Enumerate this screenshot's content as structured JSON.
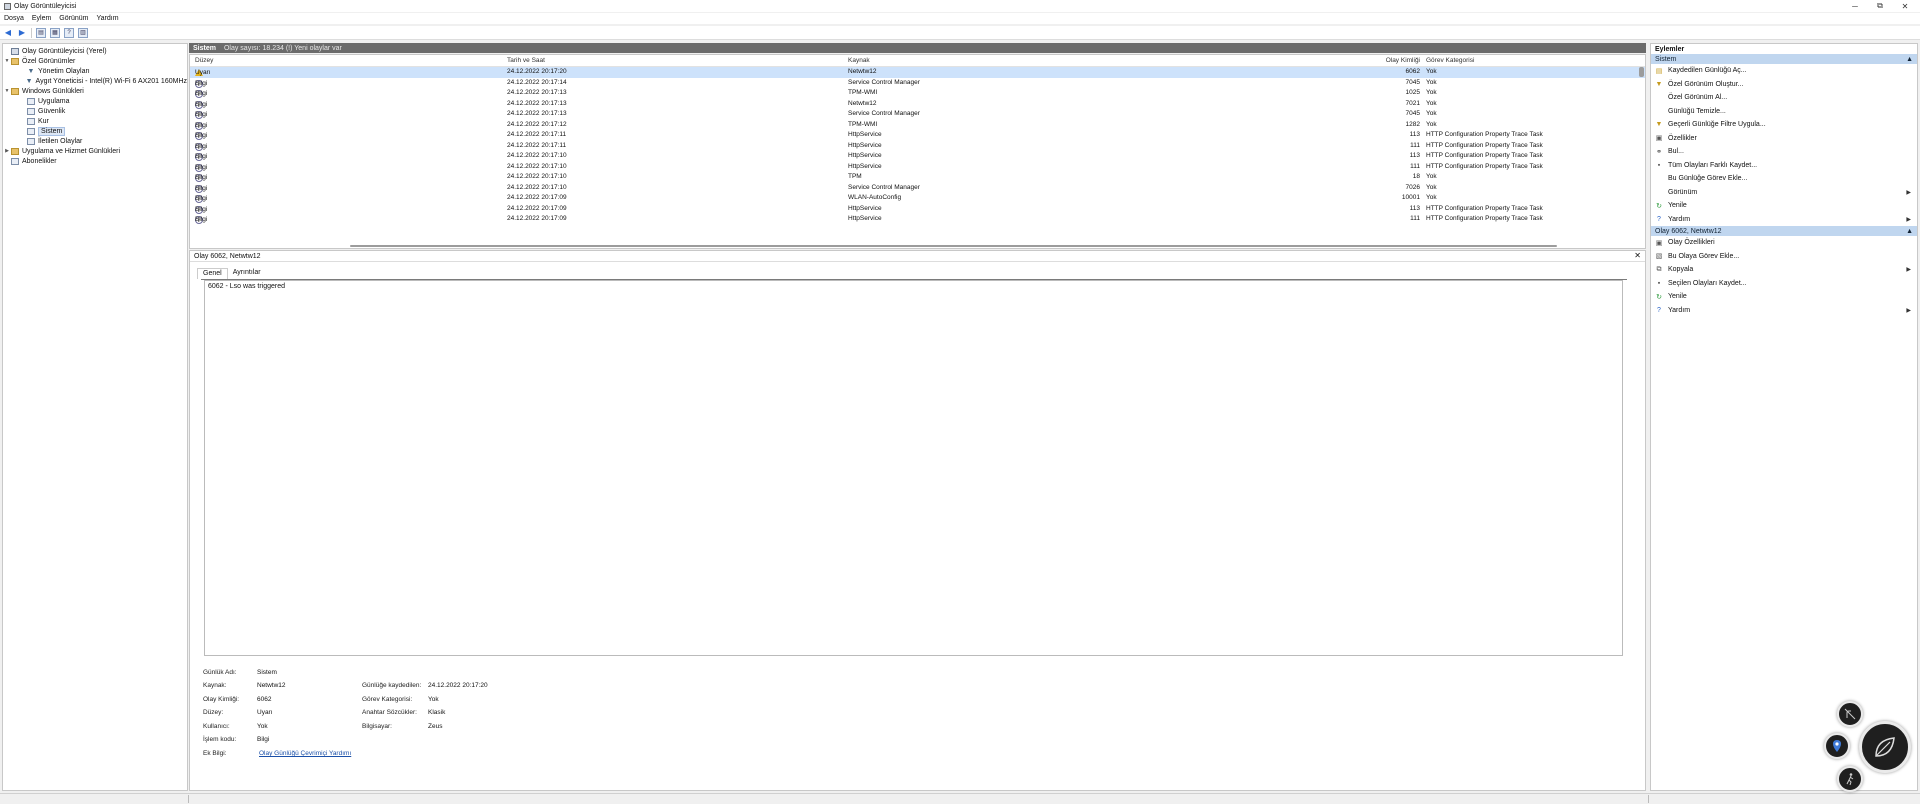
{
  "window": {
    "title": "Olay Görüntüleyicisi",
    "controls": {
      "minimize": "─",
      "maximize": "⧉",
      "close": "✕"
    }
  },
  "menu": [
    "Dosya",
    "Eylem",
    "Görünüm",
    "Yardım"
  ],
  "toolbar": {
    "icons": [
      "back-arrow-icon",
      "forward-arrow-icon",
      "folder-icon",
      "grid-icon",
      "help-icon",
      "panel-icon"
    ],
    "help_glyph": "?"
  },
  "tree": {
    "root": "Olay Görüntüleyicisi (Yerel)",
    "custom_views": "Özel Görünümler",
    "admin_events": "Yönetim Olayları",
    "device_manager": "Aygıt Yöneticisi - Intel(R) Wi-Fi 6 AX201 160MHz",
    "windows_logs": "Windows Günlükleri",
    "application": "Uygulama",
    "security": "Güvenlik",
    "setup": "Kur",
    "system": "Sistem",
    "forwarded": "İletilen Olaylar",
    "apps_services": "Uygulama ve Hizmet Günlükleri",
    "subscriptions": "Abonelikler"
  },
  "list": {
    "title": "Sistem",
    "info": "Olay sayısı: 18.234 (!) Yeni olaylar var",
    "columns": {
      "level": "Düzey",
      "date": "Tarih ve Saat",
      "source": "Kaynak",
      "id": "Olay Kimliği",
      "category": "Görev Kategorisi"
    },
    "rows": [
      {
        "level": "Uyarı",
        "type": "warn",
        "date": "24.12.2022 20:17:20",
        "source": "Netwtw12",
        "id": "6062",
        "category": "Yok"
      },
      {
        "level": "Bilgi",
        "type": "info",
        "date": "24.12.2022 20:17:14",
        "source": "Service Control Manager",
        "id": "7045",
        "category": "Yok"
      },
      {
        "level": "Bilgi",
        "type": "info",
        "date": "24.12.2022 20:17:13",
        "source": "TPM-WMI",
        "id": "1025",
        "category": "Yok"
      },
      {
        "level": "Bilgi",
        "type": "info",
        "date": "24.12.2022 20:17:13",
        "source": "Netwtw12",
        "id": "7021",
        "category": "Yok"
      },
      {
        "level": "Bilgi",
        "type": "info",
        "date": "24.12.2022 20:17:13",
        "source": "Service Control Manager",
        "id": "7045",
        "category": "Yok"
      },
      {
        "level": "Bilgi",
        "type": "info",
        "date": "24.12.2022 20:17:12",
        "source": "TPM-WMI",
        "id": "1282",
        "category": "Yok"
      },
      {
        "level": "Bilgi",
        "type": "info",
        "date": "24.12.2022 20:17:11",
        "source": "HttpService",
        "id": "113",
        "category": "HTTP Configuration Property Trace Task"
      },
      {
        "level": "Bilgi",
        "type": "info",
        "date": "24.12.2022 20:17:11",
        "source": "HttpService",
        "id": "111",
        "category": "HTTP Configuration Property Trace Task"
      },
      {
        "level": "Bilgi",
        "type": "info",
        "date": "24.12.2022 20:17:10",
        "source": "HttpService",
        "id": "113",
        "category": "HTTP Configuration Property Trace Task"
      },
      {
        "level": "Bilgi",
        "type": "info",
        "date": "24.12.2022 20:17:10",
        "source": "HttpService",
        "id": "111",
        "category": "HTTP Configuration Property Trace Task"
      },
      {
        "level": "Bilgi",
        "type": "info",
        "date": "24.12.2022 20:17:10",
        "source": "TPM",
        "id": "18",
        "category": "Yok"
      },
      {
        "level": "Bilgi",
        "type": "info",
        "date": "24.12.2022 20:17:10",
        "source": "Service Control Manager",
        "id": "7026",
        "category": "Yok"
      },
      {
        "level": "Bilgi",
        "type": "info",
        "date": "24.12.2022 20:17:09",
        "source": "WLAN-AutoConfig",
        "id": "10001",
        "category": "Yok"
      },
      {
        "level": "Bilgi",
        "type": "info",
        "date": "24.12.2022 20:17:09",
        "source": "HttpService",
        "id": "113",
        "category": "HTTP Configuration Property Trace Task"
      },
      {
        "level": "Bilgi",
        "type": "info",
        "date": "24.12.2022 20:17:09",
        "source": "HttpService",
        "id": "111",
        "category": "HTTP Configuration Property Trace Task"
      }
    ]
  },
  "detail": {
    "header": "Olay 6062, Netwtw12",
    "close": "✕",
    "tabs": [
      "Genel",
      "Ayrıntılar"
    ],
    "description": "6062 - Lso was triggered",
    "fields": {
      "log_name_label": "Günlük Adı:",
      "log_name": "Sistem",
      "source_label": "Kaynak:",
      "source": "Netwtw12",
      "logged_label": "Günlüğe kaydedilen:",
      "logged": "24.12.2022 20:17:20",
      "event_id_label": "Olay Kimliği:",
      "event_id": "6062",
      "task_label": "Görev Kategorisi:",
      "task": "Yok",
      "level_label": "Düzey:",
      "level": "Uyarı",
      "keywords_label": "Anahtar Sözcükler:",
      "keywords": "Klasik",
      "user_label": "Kullanıcı:",
      "user": "Yok",
      "computer_label": "Bilgisayar:",
      "computer": "Zeus",
      "opcode_label": "İşlem kodu:",
      "opcode": "Bilgi",
      "more_label": "Ek Bilgi:",
      "more_link": "Olay Günlüğü Çevrimiçi Yardımı"
    }
  },
  "actions": {
    "title": "Eylemler",
    "section1": "Sistem",
    "section1_items": [
      {
        "label": "Kaydedilen Günlüğü Aç...",
        "icon": "folder-icon"
      },
      {
        "label": "Özel Görünüm Oluştur...",
        "icon": "filter-icon"
      },
      {
        "label": "Özel Görünüm Al...",
        "icon": ""
      },
      {
        "label": "Günlüğü Temizle...",
        "icon": ""
      },
      {
        "label": "Geçerli Günlüğe Filtre Uygula...",
        "icon": "filter-icon"
      },
      {
        "label": "Özellikler",
        "icon": "properties-icon"
      },
      {
        "label": "Bul...",
        "icon": "binoculars-icon"
      },
      {
        "label": "Tüm Olayları Farklı Kaydet...",
        "icon": "save-icon"
      },
      {
        "label": "Bu Günlüğe Görev Ekle...",
        "icon": ""
      },
      {
        "label": "Görünüm",
        "icon": "",
        "submenu": true
      },
      {
        "label": "Yenile",
        "icon": "refresh-icon"
      },
      {
        "label": "Yardım",
        "icon": "help-icon",
        "submenu": true
      }
    ],
    "section2": "Olay 6062, Netwtw12",
    "section2_items": [
      {
        "label": "Olay Özellikleri",
        "icon": "properties-icon"
      },
      {
        "label": "Bu Olaya Görev Ekle...",
        "icon": "task-icon"
      },
      {
        "label": "Kopyala",
        "icon": "copy-icon",
        "submenu": true
      },
      {
        "label": "Seçilen Olayları Kaydet...",
        "icon": "save-icon"
      },
      {
        "label": "Yenile",
        "icon": "refresh-icon"
      },
      {
        "label": "Yardım",
        "icon": "help-icon",
        "submenu": true
      }
    ],
    "collapse": "▲",
    "submenu_arrow": "▶"
  },
  "overlay": {
    "icons": [
      "no-touch-icon",
      "map-pin-icon",
      "leaf-icon",
      "walk-icon"
    ]
  }
}
